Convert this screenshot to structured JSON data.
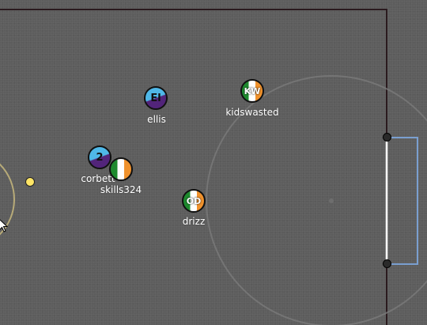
{
  "players": [
    {
      "id": "ellis",
      "name": "ellis",
      "avatar": "El",
      "team": "blue",
      "color_top": "#4fb8e8",
      "color_bottom": "#52247a"
    },
    {
      "id": "kidswasted",
      "name": "kidswasted",
      "avatar": "KW",
      "team": "ireland"
    },
    {
      "id": "corbett",
      "name": "corbett",
      "avatar": "2",
      "team": "blue",
      "color_top": "#4fb8e8",
      "color_bottom": "#52247a"
    },
    {
      "id": "skills324",
      "name": "skills324",
      "avatar": "",
      "team": "ireland"
    },
    {
      "id": "drizz",
      "name": "drizz",
      "avatar": "OD",
      "team": "ireland"
    }
  ],
  "colors": {
    "field": "#5d5d5d",
    "boundary": "#2a1a1e",
    "goal_net": "#7a9fd0",
    "goal_line": "#ffffff",
    "ball": "#ffe566",
    "left_arc": "#b7aa78",
    "center_circle": "#7a7a7a"
  },
  "icons": {
    "cursor": "mouse-pointer-icon"
  }
}
